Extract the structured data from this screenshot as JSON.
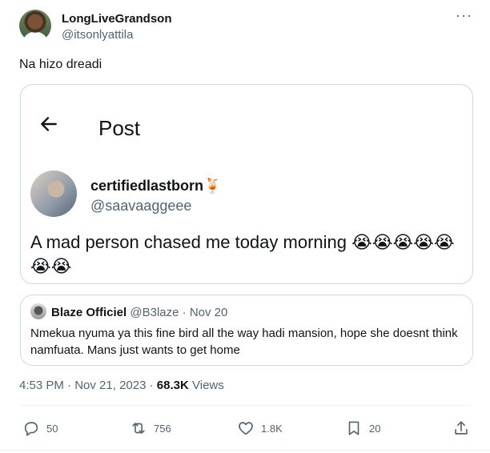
{
  "author": {
    "name": "LongLiveGrandson",
    "handle": "@itsonlyattila",
    "more_label": "···"
  },
  "tweet": {
    "text": "Na hizo dreadi"
  },
  "embedded": {
    "header_title": "Post",
    "name": "certifiedlastborn",
    "name_emoji": "🍹",
    "handle": "@saavaaggeee",
    "text": "A mad person chased me today morning 😭😭😭😭😭😭😭"
  },
  "quote": {
    "name": "Blaze Officiel",
    "handle": "@B3laze",
    "separator": "·",
    "date": "Nov 20",
    "text": "Nmekua nyuma ya this fine bird all the way hadi mansion, hope she doesnt think namfuata. Mans just wants to get home"
  },
  "meta": {
    "time": "4:53 PM",
    "sep1": "·",
    "date": "Nov 21, 2023",
    "sep2": "·",
    "views_count": "68.3K",
    "views_label": "Views"
  },
  "actions": {
    "replies": "50",
    "reposts": "756",
    "likes": "1.8K",
    "bookmarks": "20"
  },
  "icons": {
    "reply": "reply-icon",
    "repost": "repost-icon",
    "like": "heart-icon",
    "bookmark": "bookmark-icon",
    "share": "share-icon",
    "back": "back-arrow-icon"
  }
}
